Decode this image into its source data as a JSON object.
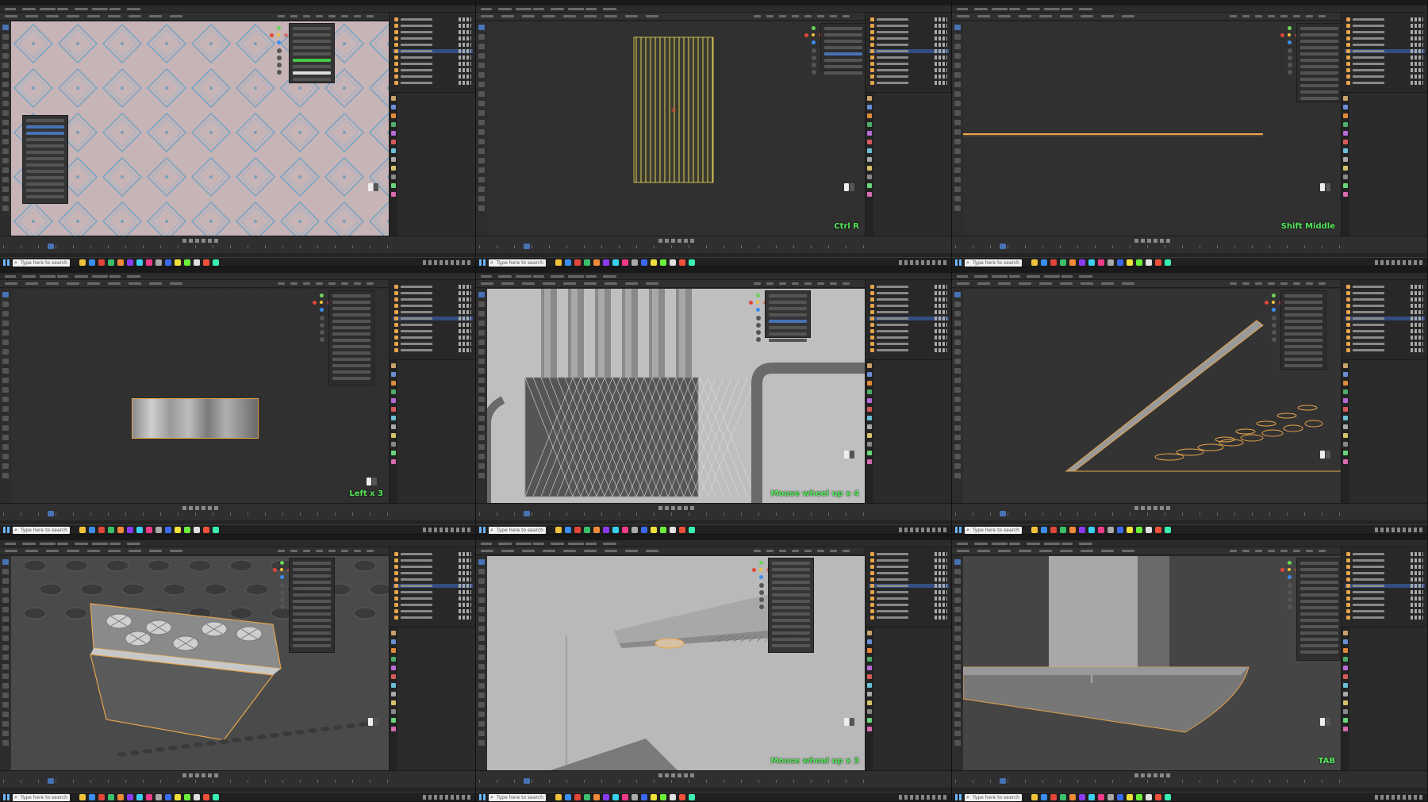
{
  "taskbar": {
    "search_placeholder": "Type here to search"
  },
  "panels": [
    {
      "id": "p1",
      "hint": ""
    },
    {
      "id": "p2",
      "hint": "Ctrl R"
    },
    {
      "id": "p3",
      "hint": "Shift Middle"
    },
    {
      "id": "p4",
      "hint": "Left x 3"
    },
    {
      "id": "p5",
      "hint": "Mouse wheel up x 4"
    },
    {
      "id": "p6",
      "hint": ""
    },
    {
      "id": "p7",
      "hint": ""
    },
    {
      "id": "p8",
      "hint": "Mouse wheel up x 3"
    },
    {
      "id": "p9",
      "hint": "TAB"
    }
  ],
  "colors": {
    "hint": "#55e65a",
    "selection_outline": "#e6a34b",
    "active_blue": "#4772b3",
    "viewport_bg": "#3d3d3d"
  }
}
